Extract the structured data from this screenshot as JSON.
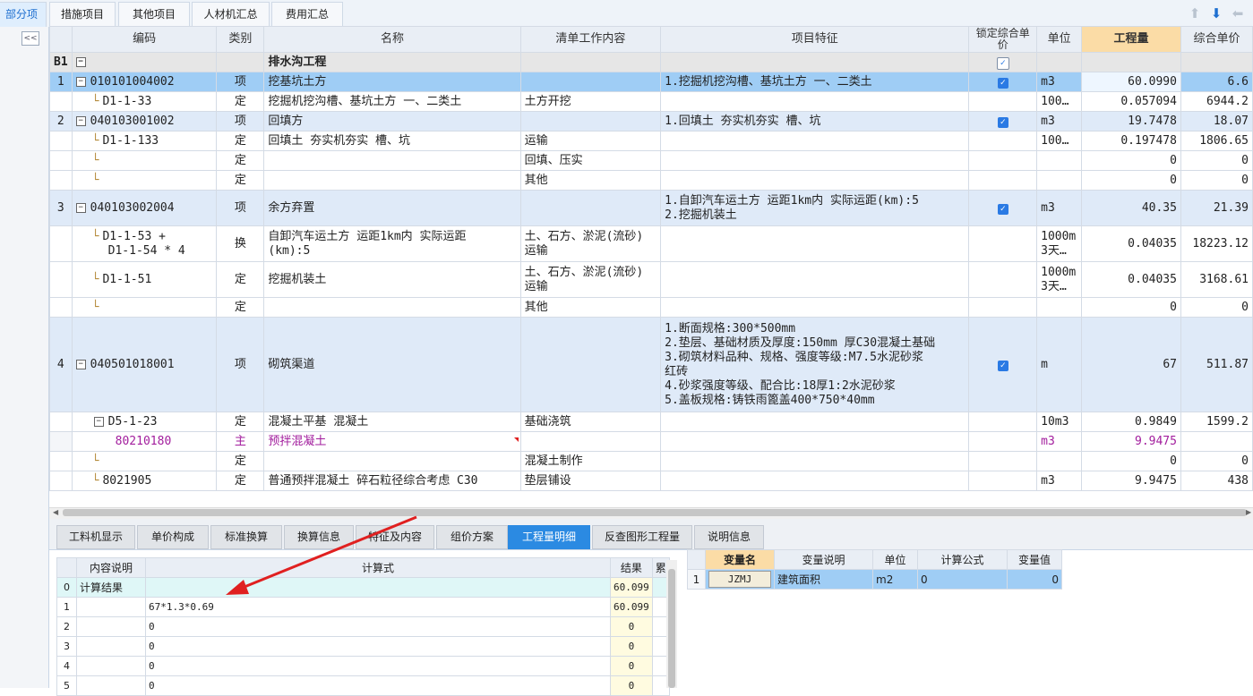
{
  "top_tabs": [
    {
      "label": "部分项",
      "active": true
    },
    {
      "label": "措施项目",
      "active": false
    },
    {
      "label": "其他项目",
      "active": false
    },
    {
      "label": "人材机汇总",
      "active": false
    },
    {
      "label": "费用汇总",
      "active": false
    }
  ],
  "collapse_label": "<<",
  "grid": {
    "headers": [
      "编码",
      "类别",
      "名称",
      "清单工作内容",
      "项目特征",
      "锁定综合单价",
      "单位",
      "工程量",
      "综合单价"
    ],
    "rows": [
      {
        "num": "B1",
        "code": "",
        "type": "",
        "name": "排水沟工程",
        "work": "",
        "feature": "",
        "lock": true,
        "unit": "",
        "qty": "",
        "price": "",
        "kind": "lvl0",
        "expand": "−"
      },
      {
        "num": "1",
        "code": "010101004002",
        "type": "项",
        "name": "挖基坑土方",
        "work": "",
        "feature": "1.挖掘机挖沟槽、基坑土方 一、二类土",
        "lock": true,
        "unit": "m3",
        "qty": "60.0990",
        "price": "6.6",
        "kind": "sel",
        "expand": "−"
      },
      {
        "num": "",
        "code": "D1-1-33",
        "type": "定",
        "name": "挖掘机挖沟槽、基坑土方 一、二类土",
        "work": "土方开挖",
        "feature": "",
        "lock": false,
        "unit": "100…",
        "qty": "0.057094",
        "price": "6944.2",
        "kind": "sub",
        "expand": ""
      },
      {
        "num": "2",
        "code": "040103001002",
        "type": "项",
        "name": "回填方",
        "work": "",
        "feature": "1.回填土 夯实机夯实 槽、坑",
        "lock": true,
        "unit": "m3",
        "qty": "19.7478",
        "price": "18.07",
        "kind": "item",
        "expand": "−"
      },
      {
        "num": "",
        "code": "D1-1-133",
        "type": "定",
        "name": "回填土 夯实机夯实 槽、坑",
        "work": "运输",
        "feature": "",
        "lock": false,
        "unit": "100…",
        "qty": "0.197478",
        "price": "1806.65",
        "kind": "sub",
        "expand": ""
      },
      {
        "num": "",
        "code": "",
        "type": "定",
        "name": "",
        "work": "回填、压实",
        "feature": "",
        "lock": false,
        "unit": "",
        "qty": "0",
        "price": "0",
        "kind": "sub",
        "expand": ""
      },
      {
        "num": "",
        "code": "",
        "type": "定",
        "name": "",
        "work": "其他",
        "feature": "",
        "lock": false,
        "unit": "",
        "qty": "0",
        "price": "0",
        "kind": "sub",
        "expand": ""
      },
      {
        "num": "3",
        "code": "040103002004",
        "type": "项",
        "name": "余方弃置",
        "work": "",
        "feature": "1.自卸汽车运土方 运距1km内  实际运距(km):5\n2.挖掘机装土",
        "lock": true,
        "unit": "m3",
        "qty": "40.35",
        "price": "21.39",
        "kind": "item",
        "expand": "−"
      },
      {
        "num": "",
        "code": "D1-1-53 +\nD1-1-54 * 4",
        "type": "换",
        "name": "自卸汽车运土方 运距1km内  实际运距\n(km):5",
        "work": "土、石方、淤泥(流砂)\n运输",
        "feature": "",
        "lock": false,
        "unit": "1000m\n3天…",
        "qty": "0.04035",
        "price": "18223.12",
        "kind": "sub",
        "expand": ""
      },
      {
        "num": "",
        "code": "D1-1-51",
        "type": "定",
        "name": "挖掘机装土",
        "work": "土、石方、淤泥(流砂)\n运输",
        "feature": "",
        "lock": false,
        "unit": "1000m\n3天…",
        "qty": "0.04035",
        "price": "3168.61",
        "kind": "sub",
        "expand": ""
      },
      {
        "num": "",
        "code": "",
        "type": "定",
        "name": "",
        "work": "其他",
        "feature": "",
        "lock": false,
        "unit": "",
        "qty": "0",
        "price": "0",
        "kind": "sub",
        "expand": ""
      },
      {
        "num": "4",
        "code": "040501018001",
        "type": "项",
        "name": "砌筑渠道",
        "work": "",
        "feature": "1.断面规格:300*500mm\n2.垫层、基础材质及厚度:150mm 厚C30混凝土基础\n3.砌筑材料品种、规格、强度等级:M7.5水泥砂浆\n红砖\n4.砂浆强度等级、配合比:18厚1:2水泥砂浆\n5.盖板规格:铸铁雨篦盖400*750*40mm",
        "lock": true,
        "unit": "m",
        "qty": "67",
        "price": "511.87",
        "kind": "item",
        "expand": "−"
      },
      {
        "num": "",
        "code": "D5-1-23",
        "type": "定",
        "name": "混凝土平基 混凝土",
        "work": "基础浇筑",
        "feature": "",
        "lock": false,
        "unit": "10m3",
        "qty": "0.9849",
        "price": "1599.2",
        "kind": "sub",
        "expand": "−"
      },
      {
        "num": "",
        "code": "80210180",
        "type": "主",
        "name": "预拌混凝土",
        "work": "",
        "feature": "",
        "lock": false,
        "unit": "m3",
        "qty": "9.9475",
        "price": "",
        "kind": "main",
        "expand": ""
      },
      {
        "num": "",
        "code": "",
        "type": "定",
        "name": "",
        "work": "混凝土制作",
        "feature": "",
        "lock": false,
        "unit": "",
        "qty": "0",
        "price": "0",
        "kind": "sub",
        "expand": ""
      },
      {
        "num": "",
        "code": "8021905",
        "type": "定",
        "name": "普通预拌混凝土 碎石粒径综合考虑 C30",
        "work": "垫层铺设",
        "feature": "",
        "lock": false,
        "unit": "m3",
        "qty": "9.9475",
        "price": "438",
        "kind": "sub",
        "expand": ""
      }
    ]
  },
  "bottom_tabs": [
    {
      "label": "工料机显示",
      "active": false
    },
    {
      "label": "单价构成",
      "active": false
    },
    {
      "label": "标准换算",
      "active": false
    },
    {
      "label": "换算信息",
      "active": false
    },
    {
      "label": "特征及内容",
      "active": false
    },
    {
      "label": "组价方案",
      "active": false
    },
    {
      "label": "工程量明细",
      "active": true
    },
    {
      "label": "反查图形工程量",
      "active": false
    },
    {
      "label": "说明信息",
      "active": false
    }
  ],
  "calc_grid": {
    "headers": [
      "",
      "内容说明",
      "计算式",
      "结果",
      "累"
    ],
    "rows": [
      {
        "num": "0",
        "desc": "计算结果",
        "expr": "",
        "result": "60.099"
      },
      {
        "num": "1",
        "desc": "",
        "expr": "67*1.3*0.69",
        "result": "60.099"
      },
      {
        "num": "2",
        "desc": "",
        "expr": "0",
        "result": "0"
      },
      {
        "num": "3",
        "desc": "",
        "expr": "0",
        "result": "0"
      },
      {
        "num": "4",
        "desc": "",
        "expr": "0",
        "result": "0"
      },
      {
        "num": "5",
        "desc": "",
        "expr": "0",
        "result": "0"
      }
    ]
  },
  "var_grid": {
    "headers": [
      "",
      "变量名",
      "变量说明",
      "单位",
      "计算公式",
      "变量值"
    ],
    "rows": [
      {
        "num": "1",
        "name": "JZMJ",
        "desc": "建筑面积",
        "unit": "m2",
        "formula": "0",
        "value": "0"
      }
    ]
  },
  "colors": {
    "accent": "#2b8ae2",
    "selected_row": "#9fcdf5",
    "item_row": "#dfeaf8",
    "header_highlight": "#fbdca6",
    "annotation_arrow": "#e02020"
  }
}
